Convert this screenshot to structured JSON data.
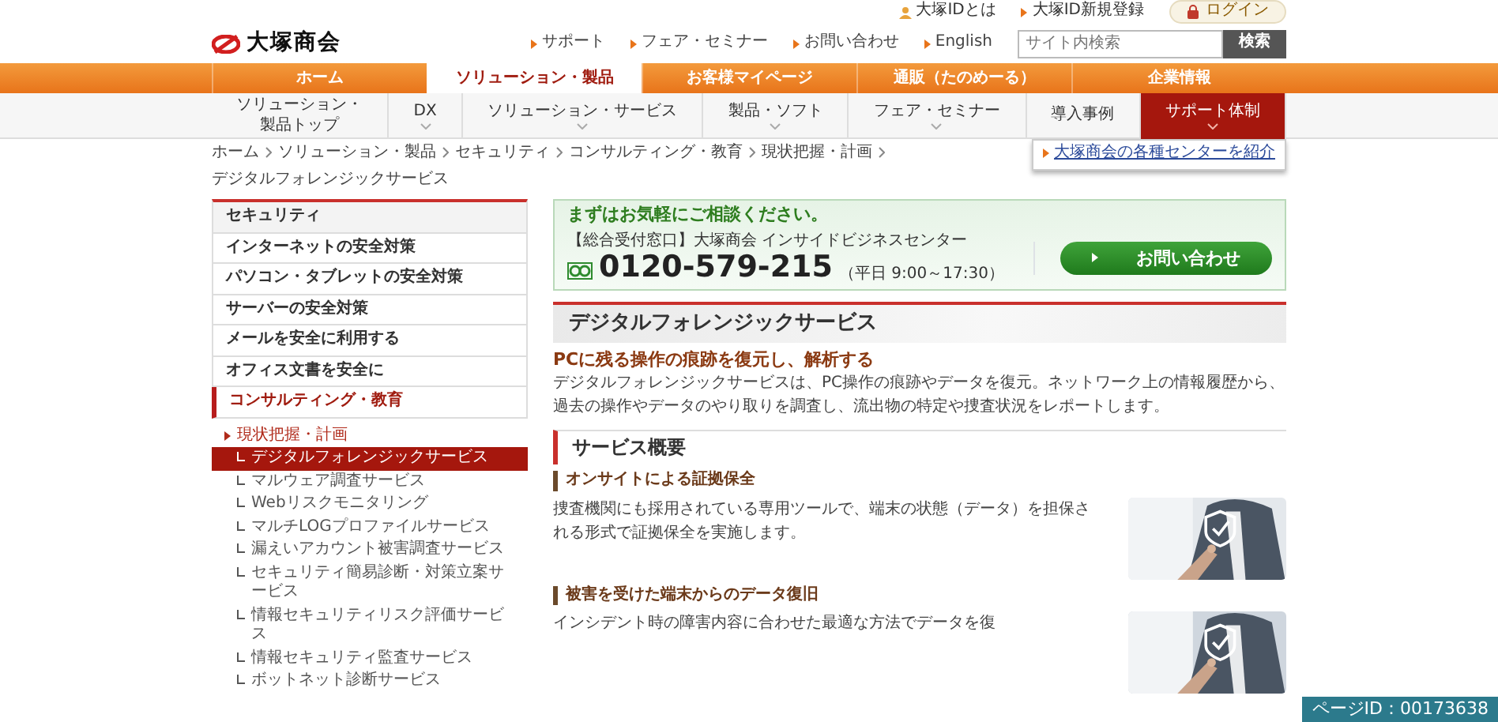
{
  "top_bar": {
    "links": [
      {
        "label": "大塚IDとは",
        "kind": "person"
      },
      {
        "label": "大塚ID新規登録",
        "kind": "arrow"
      }
    ],
    "login": "ログイン"
  },
  "header": {
    "logo": "大塚商会",
    "links": [
      "サポート",
      "フェア・セミナー",
      "お問い合わせ",
      "English"
    ],
    "search": {
      "placeholder": "サイト内検索",
      "button": "検索"
    }
  },
  "main_nav": [
    {
      "label": "ホーム",
      "selected": false
    },
    {
      "label": "ソリューション・製品",
      "selected": true
    },
    {
      "label": "お客様マイページ",
      "selected": false
    },
    {
      "label": "通販（たのめーる）",
      "selected": false
    },
    {
      "label": "企業情報",
      "selected": false
    }
  ],
  "sub_nav": [
    {
      "label": "ソリューション・製品トップ",
      "selected": false,
      "has_menu": false
    },
    {
      "label": "DX",
      "selected": false,
      "has_menu": true
    },
    {
      "label": "ソリューション・サービス",
      "selected": false,
      "has_menu": true
    },
    {
      "label": "製品・ソフト",
      "selected": false,
      "has_menu": true
    },
    {
      "label": "フェア・セミナー",
      "selected": false,
      "has_menu": true
    },
    {
      "label": "導入事例",
      "selected": false,
      "has_menu": false
    },
    {
      "label": "サポート体制",
      "selected": true,
      "has_menu": true
    }
  ],
  "dropdown": {
    "items": [
      "大塚商会の各種センターを紹介"
    ]
  },
  "breadcrumb": [
    "ホーム",
    "ソリューション・製品",
    "セキュリティ",
    "コンサルティング・教育",
    "現状把握・計画",
    "デジタルフォレンジックサービス"
  ],
  "sidebar": {
    "title": "セキュリティ",
    "items": [
      {
        "label": "インターネットの安全対策",
        "selected": false
      },
      {
        "label": "パソコン・タブレットの安全対策",
        "selected": false
      },
      {
        "label": "サーバーの安全対策",
        "selected": false
      },
      {
        "label": "メールを安全に利用する",
        "selected": false
      },
      {
        "label": "オフィス文書を安全に",
        "selected": false
      },
      {
        "label": "コンサルティング・教育",
        "selected": true,
        "children": [
          {
            "label": "現状把握・計画",
            "expanded": true,
            "children": [
              {
                "label": "デジタルフォレンジックサービス",
                "selected": true
              },
              {
                "label": "マルウェア調査サービス",
                "selected": false
              },
              {
                "label": "Webリスクモニタリング",
                "selected": false
              },
              {
                "label": "マルチLOGプロファイルサービス",
                "selected": false
              },
              {
                "label": "漏えいアカウント被害調査サービス",
                "selected": false
              },
              {
                "label": "セキュリティ簡易診断・対策立案サービス",
                "selected": false
              },
              {
                "label": "情報セキュリティリスク評価サービス",
                "selected": false
              },
              {
                "label": "情報セキュリティ監査サービス",
                "selected": false
              },
              {
                "label": "ボットネット診断サービス",
                "selected": false
              }
            ]
          }
        ]
      }
    ]
  },
  "contact": {
    "heading": "まずはお気軽にご相談ください。",
    "desk": "【総合受付窓口】大塚商会 インサイドビジネスセンター",
    "phone": "0120-579-215",
    "hours": "（平日 9:00～17:30）",
    "button": "お問い合わせ"
  },
  "page_title": "デジタルフォレンジックサービス",
  "lead": {
    "heading": "PCに残る操作の痕跡を復元し、解析する",
    "text": "デジタルフォレンジックサービスは、PC操作の痕跡やデータを復元。ネットワーク上の情報履歴から、過去の操作やデータのやり取りを調査し、流出物の特定や捜査状況をレポートします。"
  },
  "section": {
    "title": "サービス概要",
    "subsections": [
      {
        "title": "オンサイトによる証拠保全",
        "text": "捜査機関にも採用されている専用ツールで、端末の状態（データ）を担保される形式で証拠保全を実施します。"
      },
      {
        "title": "被害を受けた端末からのデータ復旧",
        "text": "インシデント時の障害内容に合わせた最適な方法でデータを復"
      }
    ]
  },
  "page_id": "ページID：00173638"
}
